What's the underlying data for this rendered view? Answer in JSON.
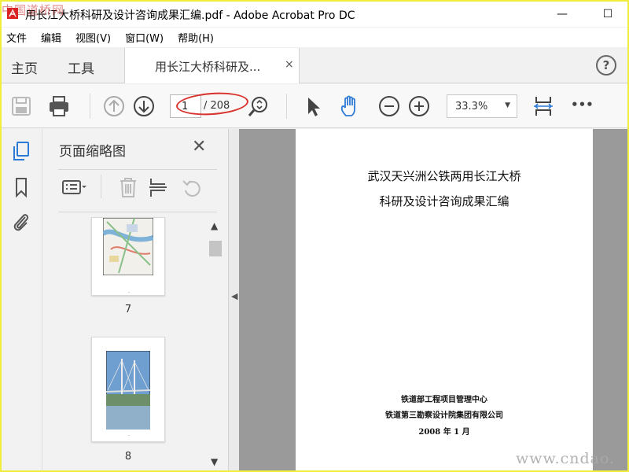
{
  "window": {
    "title": "用长江大桥科研及设计咨询成果汇编.pdf - Adobe Acrobat Pro DC",
    "watermark_top": "中国道桥网",
    "watermark_bottom": "www.cndao.",
    "minimize_glyph": "—",
    "maximize_glyph": "☐"
  },
  "menubar": {
    "items": [
      "文件",
      "编辑",
      "视图(V)",
      "窗口(W)",
      "帮助(H)"
    ]
  },
  "tabs": {
    "home": "主页",
    "tools": "工具",
    "document": "用长江大桥科研及...",
    "close": "×",
    "help": "?"
  },
  "toolbar": {
    "page_current": "1",
    "page_total": "/ 208",
    "zoom": "33.3%",
    "more": "•••"
  },
  "panel": {
    "title": "页面缩略图",
    "close": "✕",
    "thumbnails": [
      {
        "page": "7"
      },
      {
        "page": "8"
      }
    ]
  },
  "document": {
    "title_line1": "武汉天兴洲公铁两用长江大桥",
    "title_line2": "科研及设计咨询成果汇编",
    "org_line1": "铁道部工程项目管理中心",
    "org_line2": "铁道第三勘察设计院集团有限公司",
    "date": "2008 年 1 月"
  },
  "colors": {
    "border_yellow": "#f0ee3c",
    "annotation_red": "#d9312b",
    "accent_blue": "#2d7ad6"
  }
}
